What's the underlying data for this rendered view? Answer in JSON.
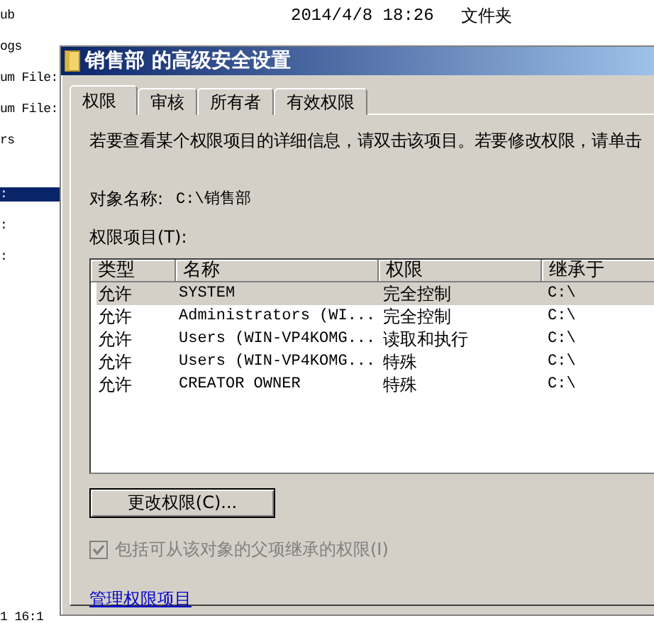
{
  "background_window": {
    "rows": [
      {
        "name": "ub",
        "date": "2014/4/8 18:26",
        "type": "文件夹",
        "selected": false
      },
      {
        "name": "ogs",
        "selected": false
      },
      {
        "name": "um File:",
        "selected": false
      },
      {
        "name": "um File:",
        "selected": false
      },
      {
        "name": "rs",
        "selected": false
      },
      {
        "name": ":",
        "selected": true
      },
      {
        "name": ":",
        "selected": false
      },
      {
        "name": ":",
        "selected": false
      }
    ],
    "footer_text": "1 16:1"
  },
  "dialog": {
    "title": "销售部 的高级安全设置",
    "tabs": [
      {
        "label": "权限",
        "selected": true
      },
      {
        "label": "审核",
        "selected": false
      },
      {
        "label": "所有者",
        "selected": false
      },
      {
        "label": "有效权限",
        "selected": false
      }
    ],
    "description": "若要查看某个权限项目的详细信息，请双击该项目。若要修改权限，请单击",
    "object_name_label": "对象名称:",
    "object_name": "C:\\销售部",
    "entries_label": "权限项目(T):",
    "table": {
      "columns": [
        "类型",
        "名称",
        "权限",
        "继承于"
      ],
      "rows": [
        {
          "cells": [
            "允许",
            "SYSTEM",
            "完全控制",
            "C:\\"
          ],
          "selected": true
        },
        {
          "cells": [
            "允许",
            "Administrators (WI...",
            "完全控制",
            "C:\\"
          ],
          "selected": false
        },
        {
          "cells": [
            "允许",
            "Users (WIN-VP4KOMG...",
            "读取和执行",
            "C:\\"
          ],
          "selected": false
        },
        {
          "cells": [
            "允许",
            "Users (WIN-VP4KOMG...",
            "特殊",
            "C:\\"
          ],
          "selected": false
        },
        {
          "cells": [
            "允许",
            "CREATOR OWNER",
            "特殊",
            "C:\\"
          ],
          "selected": false
        }
      ]
    },
    "change_button": "更改权限(C)...",
    "inherit_checkbox": {
      "label": "包括可从该对象的父项继承的权限(I)",
      "checked": true,
      "disabled": true
    },
    "manage_link": "管理权限项目"
  }
}
